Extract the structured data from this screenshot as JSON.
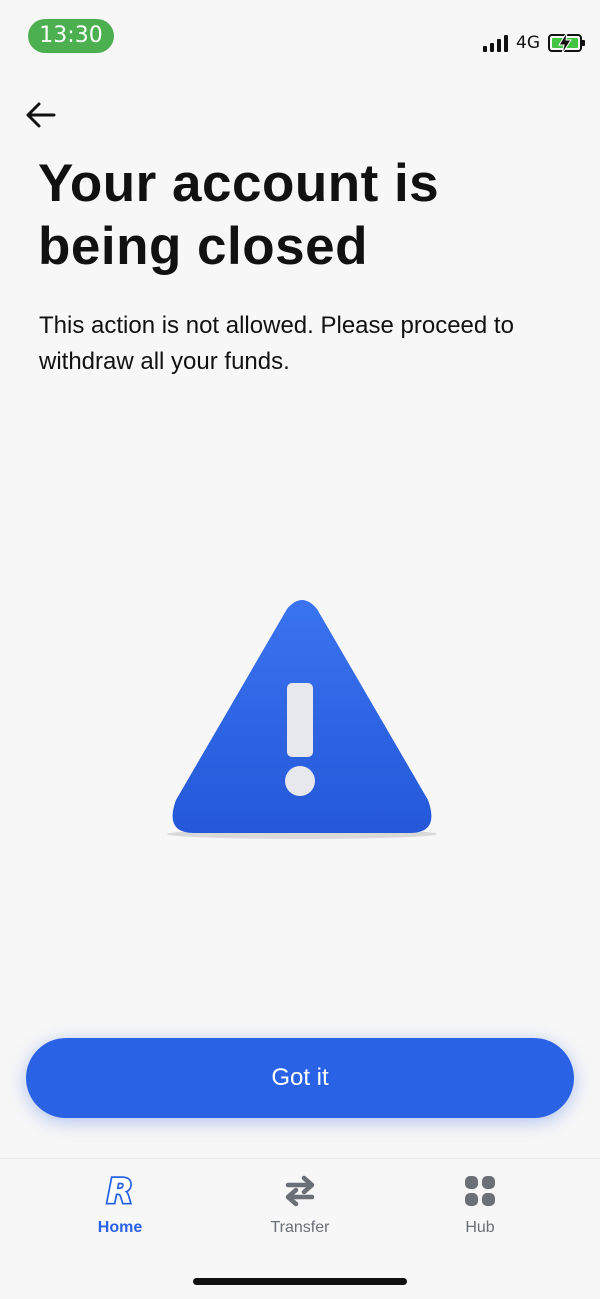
{
  "status_bar": {
    "time": "13:30",
    "network": "4G",
    "signal_icon": "signal-bars-icon",
    "battery_icon": "battery-charging-icon",
    "colors": {
      "time_pill": "#4caf50",
      "battery_fill": "#43c443"
    }
  },
  "header": {
    "back_icon": "arrow-left-icon"
  },
  "main": {
    "title": "Your account is being closed",
    "message": "This action is not allowed. Please proceed to withdraw all your funds.",
    "illustration_icon": "warning-triangle-icon"
  },
  "action": {
    "primary_label": "Got it"
  },
  "tabbar": {
    "tabs": [
      {
        "label": "Home",
        "icon": "revolut-r-icon",
        "active": true
      },
      {
        "label": "Transfer",
        "icon": "transfer-arrows-icon",
        "active": false
      },
      {
        "label": "Hub",
        "icon": "grid-icon",
        "active": false
      }
    ]
  },
  "colors": {
    "accent": "#2a62e6",
    "background": "#f7f7f7",
    "text": "#111111",
    "inactive_tab": "#6b6f76"
  }
}
